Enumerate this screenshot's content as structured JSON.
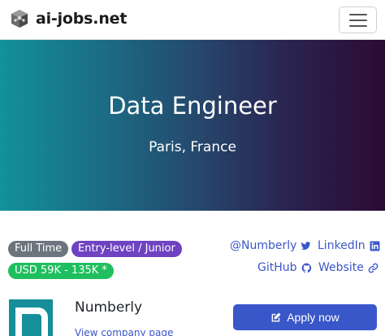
{
  "nav": {
    "brand": "ai-jobs.net",
    "logo_icon": "brain-logo-icon",
    "menu_icon": "hamburger-menu-icon"
  },
  "hero": {
    "title": "Data Engineer",
    "location": "Paris, France",
    "gradient_start": "#12929b",
    "gradient_end": "#2c0a33"
  },
  "badges": {
    "type": "Full Time",
    "level": "Entry-level / Junior",
    "salary": "USD 59K - 135K *"
  },
  "links": {
    "twitter": "@Numberly",
    "linkedin": "LinkedIn",
    "github": "GitHub",
    "website": "Website"
  },
  "company": {
    "name": "Numberly",
    "page_link": "View company page"
  },
  "apply": {
    "label": "Apply now",
    "color": "#3a57c9"
  }
}
